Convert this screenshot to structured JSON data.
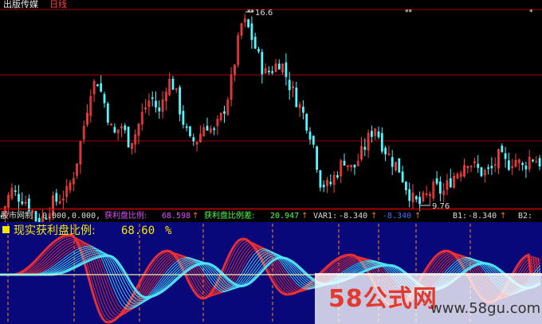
{
  "header": {
    "title": "出版传媒",
    "period": "日线"
  },
  "colors": {
    "up": "#ff4040",
    "down": "#54f6ff",
    "grid": "#a00000",
    "subbg": "#08087a",
    "profit": "#f23232",
    "cyanwave": "#4fe8ff",
    "tick_orange": "#ff8c1a",
    "zero_line": "#f2efb0"
  },
  "price_annotations": {
    "high_label": "16.6",
    "low_label": "9.76",
    "star_marks": [
      "**",
      "**",
      "*"
    ]
  },
  "indicator_bar": {
    "name": "股市网制",
    "v1": "0.000,",
    "v2": "0.000,",
    "profit_ratio_label": "获利盘比例:",
    "profit_ratio_value": "68.598",
    "profit_ratio_diff_label": "获利盘比例差:",
    "profit_ratio_diff_value": "20.947",
    "var1_label": "VAR1:",
    "var1_value": "-8.340",
    "var1b_value": "-8.340",
    "b1_label": "B1:",
    "b1_value": "-8.340",
    "b2_label": "B2:",
    "up_arrow": "↑"
  },
  "subpanel": {
    "title": "现实获利盘比例:",
    "value": "68.60",
    "unit": "%"
  },
  "watermark": {
    "brand": "58公式网",
    "url": "www.58gu.com"
  },
  "chart_data": {
    "type": "candlestick",
    "title": "出版传媒 日线",
    "high": 16.6,
    "low": 9.76,
    "candles": []
  }
}
